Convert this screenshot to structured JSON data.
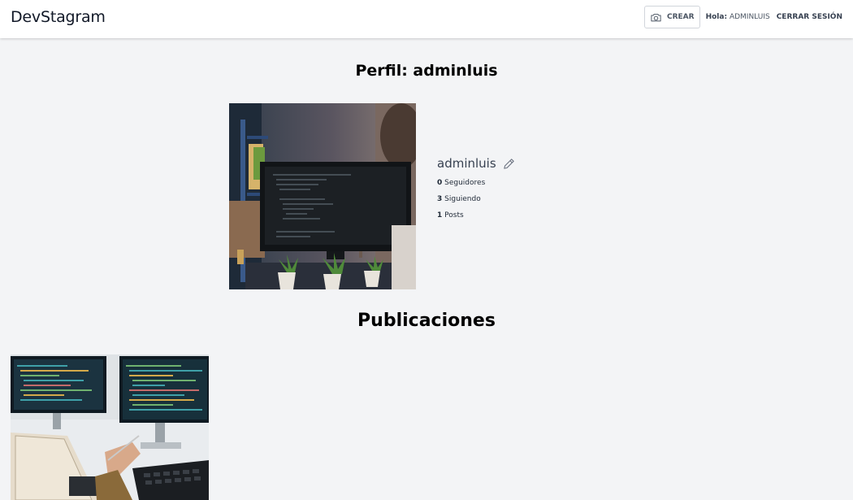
{
  "header": {
    "brand": "DevStagram",
    "create_label": "Crear",
    "greeting_prefix": "Hola:",
    "greeting_user": "adminluis",
    "logout_label": "Cerrar Sesión"
  },
  "profile": {
    "title": "Perfil: adminluis",
    "username": "adminluis",
    "followers_count": "0",
    "followers_label": "Seguidores",
    "following_count": "3",
    "following_label": "Siguiendo",
    "posts_count": "1",
    "posts_label": "Posts"
  },
  "publications": {
    "title": "Publicaciones"
  },
  "icons": {
    "create": "camera-icon",
    "edit": "pencil-icon"
  }
}
